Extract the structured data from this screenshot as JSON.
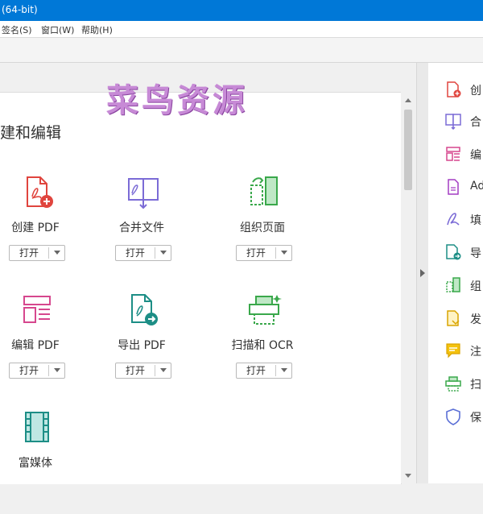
{
  "window": {
    "title_partial": "(64-bit)"
  },
  "menu": [
    "签名(S)",
    "窗口(W)",
    "帮助(H)"
  ],
  "watermark": "菜鸟资源",
  "section_title": "建和编辑",
  "tools": [
    {
      "label": "创建 PDF",
      "button": "打开",
      "icon": "create-pdf-icon",
      "color": "#e0453e"
    },
    {
      "label": "合并文件",
      "button": "打开",
      "icon": "combine-files-icon",
      "color": "#7b6bd6"
    },
    {
      "label": "组织页面",
      "button": "打开",
      "icon": "organize-pages-icon",
      "color": "#3aa84b"
    },
    {
      "label": "编辑 PDF",
      "button": "打开",
      "icon": "edit-pdf-icon",
      "color": "#d6478e"
    },
    {
      "label": "导出 PDF",
      "button": "打开",
      "icon": "export-pdf-icon",
      "color": "#1d8e86"
    },
    {
      "label": "扫描和 OCR",
      "button": "打开",
      "icon": "scan-ocr-icon",
      "color": "#3aa84b"
    },
    {
      "label": "富媒体",
      "icon": "rich-media-icon",
      "color": "#1d8e86"
    }
  ],
  "right_tools": [
    {
      "label": "创",
      "icon": "create-pdf-icon"
    },
    {
      "label": "合",
      "icon": "combine-files-icon"
    },
    {
      "label": "编",
      "icon": "edit-pdf-icon"
    },
    {
      "label": "Ad",
      "icon": "adobe-sign-icon"
    },
    {
      "label": "填",
      "icon": "fill-sign-icon"
    },
    {
      "label": "导",
      "icon": "export-pdf-icon"
    },
    {
      "label": "组",
      "icon": "organize-pages-icon"
    },
    {
      "label": "发",
      "icon": "send-file-icon"
    },
    {
      "label": "注",
      "icon": "comment-icon"
    },
    {
      "label": "扫",
      "icon": "scan-icon"
    },
    {
      "label": "保",
      "icon": "protect-icon"
    }
  ]
}
